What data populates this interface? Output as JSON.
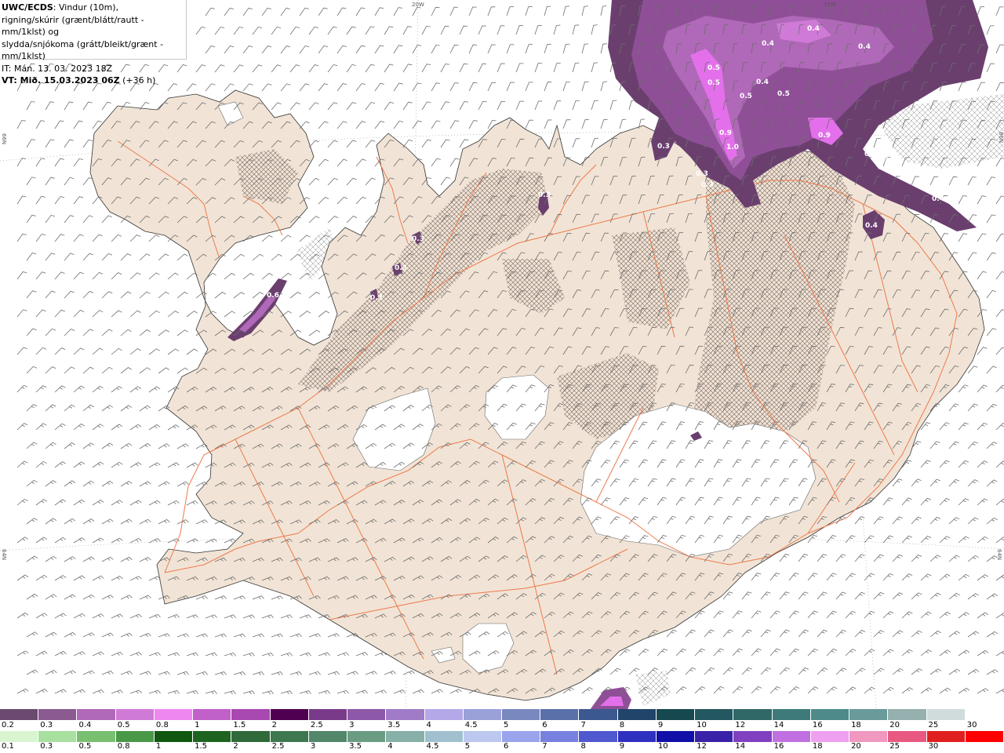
{
  "header": {
    "line1_bold": "UWC/ECDS",
    "line1_rest": ": Vindur (10m),",
    "line2": "rigning/skúrir (grænt/blátt/rautt - mm/1klst) og",
    "line3": "slydda/snjókoma (grátt/bleikt/grænt - mm/1klst)",
    "line4": "IT: Mán. 13. 03. 2023 18Z",
    "line5_bold": "VT: Mið. 15.03.2023 06Z",
    "line5_rest": " (+36 h)"
  },
  "grid_labels": {
    "top_20w": "20W",
    "top_15w": "15W",
    "left_66n": "66N",
    "right_66n": "66N",
    "left_64n": "64N",
    "right_64n": "64N"
  },
  "contour_labels": {
    "l01": "0.4",
    "l02": "0.4",
    "l03": "0.4",
    "l04": "0.5",
    "l05": "0.5",
    "l06": "0.4",
    "l07": "0.5",
    "l08": "0.5",
    "l09": "0.9",
    "l10": "1.0",
    "l11": "0.9",
    "l12": "0.3",
    "l13": "0.3",
    "l14": "0.3",
    "l15": "0.3",
    "l16": "0.3",
    "l17": "0.4",
    "l18": "0.4",
    "l19": "0.6",
    "l20": "0.3",
    "l21": "0.3",
    "l22": "0.3",
    "l23": "0.3"
  },
  "snow_scale": {
    "labels": [
      "0.2",
      "0.3",
      "0.4",
      "0.5",
      "0.8",
      "1",
      "1.5",
      "2",
      "2.5",
      "3",
      "3.5",
      "4",
      "4.5",
      "5",
      "6",
      "7",
      "8",
      "9",
      "10",
      "12",
      "14",
      "16",
      "18",
      "20",
      "25",
      "30"
    ],
    "colors": [
      "#6a4a6e",
      "#8a5a90",
      "#b068b8",
      "#d07ad8",
      "#ee88f0",
      "#c060c8",
      "#a848b0",
      "#500050",
      "#7a3a8a",
      "#8e58a8",
      "#a07cc8",
      "#b4a8e8",
      "#9aa0d8",
      "#7a88c0",
      "#5a70a8",
      "#3c5890",
      "#20446a",
      "#164850",
      "#245860",
      "#306868",
      "#3e7a7a",
      "#4e8a8a",
      "#6a9a9a",
      "#96b0b0",
      "#d0dcdc",
      "#ffffff"
    ]
  },
  "rain_scale": {
    "labels": [
      "0.1",
      "0.3",
      "0.5",
      "0.8",
      "1",
      "1.5",
      "2",
      "2.5",
      "3",
      "3.5",
      "4",
      "4.5",
      "5",
      "6",
      "7",
      "8",
      "9",
      "10",
      "12",
      "14",
      "16",
      "18",
      "20",
      "25",
      "30"
    ],
    "colors": [
      "#d8f5d0",
      "#a8e0a0",
      "#78c070",
      "#489848",
      "#105810",
      "#1e6420",
      "#306a3a",
      "#3e7850",
      "#52876a",
      "#6a9c84",
      "#86b0a8",
      "#a0c0d0",
      "#bcc8f0",
      "#9aa4ec",
      "#7880e0",
      "#5058d0",
      "#3030c0",
      "#1010a8",
      "#3a22a8",
      "#8040c0",
      "#c070e0",
      "#f0a0f0",
      "#f098c0",
      "#e85880",
      "#e02020",
      "#ff0000"
    ]
  },
  "colors": {
    "land": "#f1e4d6",
    "roads": "#ee7a4c",
    "wind": "#6e6e6e",
    "glacier": "#ffffff",
    "precip_light": "#6a3f6e",
    "precip_mid": "#8f4f97",
    "precip_heavy": "#e370ea"
  }
}
